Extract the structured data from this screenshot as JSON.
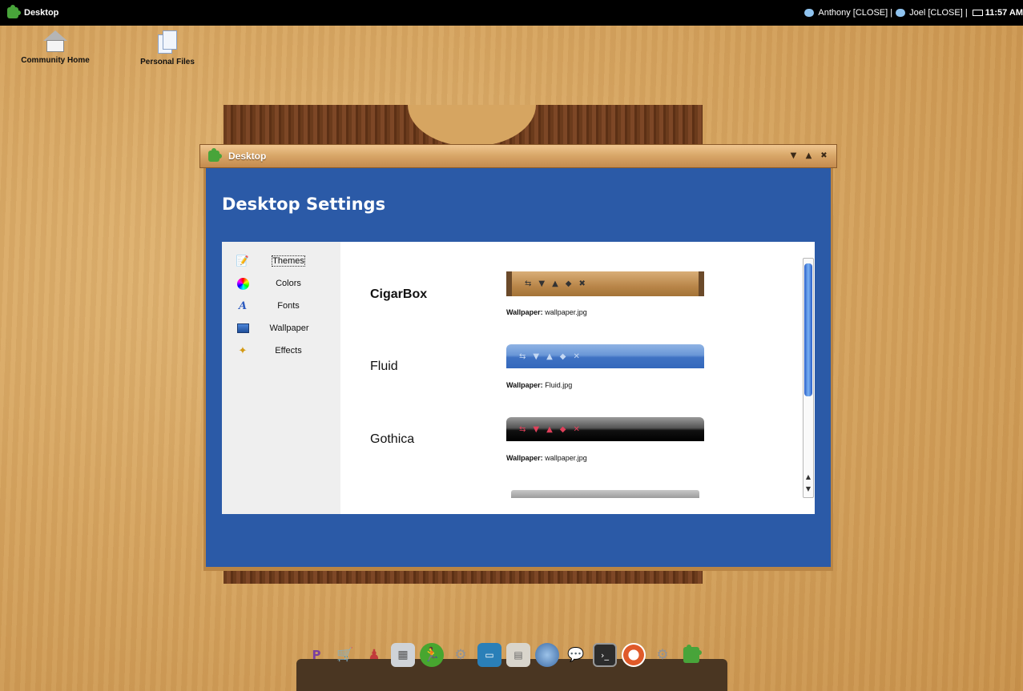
{
  "taskbar": {
    "app_title": "Desktop",
    "chats": [
      {
        "name": "Anthony",
        "close": "[CLOSE]",
        "sep": "|"
      },
      {
        "name": "Joel",
        "close": "[CLOSE]",
        "sep": "|"
      }
    ],
    "clock": "11:57 AM"
  },
  "desktop_icons": [
    {
      "label": "Community Home",
      "icon": "house-icon"
    },
    {
      "label": "Personal Files",
      "icon": "files-icon"
    }
  ],
  "window": {
    "title": "Desktop",
    "heading": "Desktop Settings",
    "controls": [
      "minimize-icon",
      "maximize-icon",
      "close-icon"
    ]
  },
  "sidebar": {
    "items": [
      {
        "label": "Themes",
        "icon": "pencil-note-icon",
        "active": true
      },
      {
        "label": "Colors",
        "icon": "color-wheel-icon"
      },
      {
        "label": "Fonts",
        "icon": "font-a-icon"
      },
      {
        "label": "Wallpaper",
        "icon": "picture-icon"
      },
      {
        "label": "Effects",
        "icon": "magic-wand-icon"
      }
    ]
  },
  "themes": [
    {
      "name": "CigarBox",
      "wallpaper_label": "Wallpaper:",
      "wallpaper_file": "wallpaper.jpg",
      "selected": true
    },
    {
      "name": "Fluid",
      "wallpaper_label": "Wallpaper:",
      "wallpaper_file": "Fluid.jpg"
    },
    {
      "name": "Gothica",
      "wallpaper_label": "Wallpaper:",
      "wallpaper_file": "wallpaper.jpg"
    }
  ],
  "colors": {
    "window_body": "#2b5aa7",
    "taskbar": "#000000",
    "wood": "#d6a561"
  },
  "dock": {
    "icons": [
      "pim-icon",
      "cart-icon",
      "users-icon",
      "calculator-icon",
      "runner-icon",
      "gear-icon",
      "monitor-icon",
      "folders-icon",
      "globe-icon",
      "chat-icon",
      "terminal-icon",
      "lifebuoy-icon",
      "settings-icon",
      "puzzle-icon"
    ]
  }
}
